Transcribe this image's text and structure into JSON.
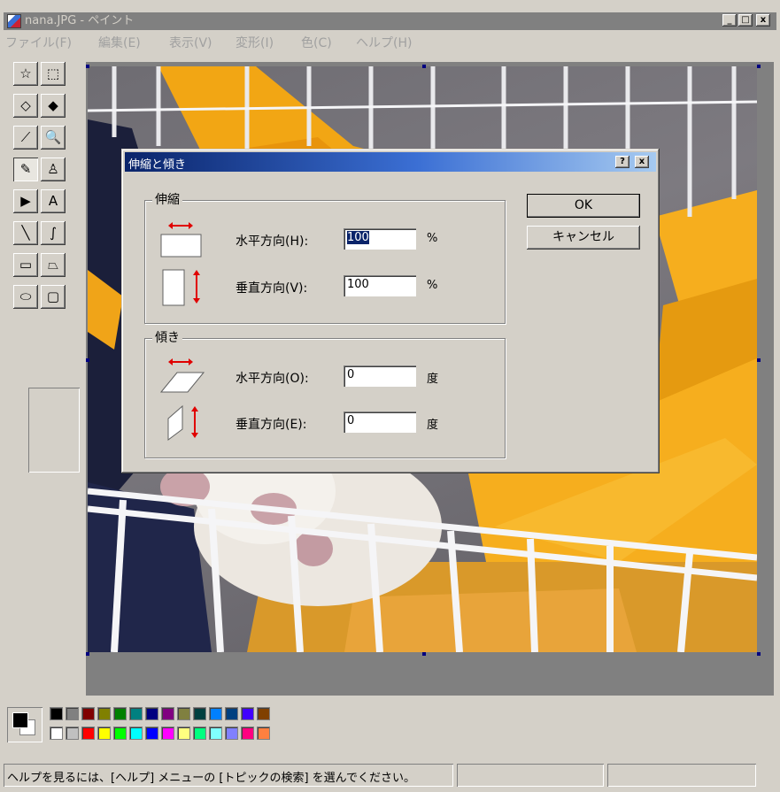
{
  "window": {
    "title": "nana.JPG - ペイント",
    "controls": {
      "minimize": "_",
      "maximize": "□",
      "close": "x"
    }
  },
  "menu": [
    "ファイル(F)",
    "編集(E)",
    "表示(V)",
    "変形(I)",
    "色(C)",
    "ヘルプ(H)"
  ],
  "tools": [
    {
      "name": "free-select-tool",
      "glyph": "☆"
    },
    {
      "name": "rect-select-tool",
      "glyph": "⬚"
    },
    {
      "name": "eraser-tool",
      "glyph": "◇"
    },
    {
      "name": "fill-tool",
      "glyph": "◆"
    },
    {
      "name": "color-picker-tool",
      "glyph": "⟋"
    },
    {
      "name": "magnifier-tool",
      "glyph": "🔍"
    },
    {
      "name": "pencil-tool",
      "glyph": "✎"
    },
    {
      "name": "brush-tool",
      "glyph": "♙"
    },
    {
      "name": "airbrush-tool",
      "glyph": "▶"
    },
    {
      "name": "text-tool",
      "glyph": "A"
    },
    {
      "name": "line-tool",
      "glyph": "╲"
    },
    {
      "name": "curve-tool",
      "glyph": "∫"
    },
    {
      "name": "rectangle-tool",
      "glyph": "▭"
    },
    {
      "name": "polygon-tool",
      "glyph": "⏢"
    },
    {
      "name": "ellipse-tool",
      "glyph": "⬭"
    },
    {
      "name": "rounded-rect-tool",
      "glyph": "▢"
    }
  ],
  "colors": {
    "foreground": "#000000",
    "background": "#ffffff",
    "palette_top": [
      "#000000",
      "#808080",
      "#800000",
      "#808000",
      "#008000",
      "#008080",
      "#000080",
      "#800080",
      "#808040",
      "#004040",
      "#0080ff",
      "#004080",
      "#4000ff",
      "#804000"
    ],
    "palette_bottom": [
      "#ffffff",
      "#c0c0c0",
      "#ff0000",
      "#ffff00",
      "#00ff00",
      "#00ffff",
      "#0000ff",
      "#ff00ff",
      "#ffff80",
      "#00ff80",
      "#80ffff",
      "#8080ff",
      "#ff0080",
      "#ff8040"
    ]
  },
  "status": {
    "help_text": "ヘルプを見るには、[ヘルプ] メニューの [トピックの検索] を選んでください。"
  },
  "dialog": {
    "title": "伸縮と傾き",
    "help_btn": "?",
    "close_btn": "x",
    "stretch_group": "伸縮",
    "stretch_horizontal_label": "水平方向(H):",
    "stretch_horizontal_value": "100",
    "stretch_vertical_label": "垂直方向(V):",
    "stretch_vertical_value": "100",
    "percent_unit": "%",
    "skew_group": "傾き",
    "skew_horizontal_label": "水平方向(O):",
    "skew_horizontal_value": "0",
    "skew_vertical_label": "垂直方向(E):",
    "skew_vertical_value": "0",
    "degree_unit": "度",
    "ok_label": "OK",
    "cancel_label": "キャンセル"
  }
}
